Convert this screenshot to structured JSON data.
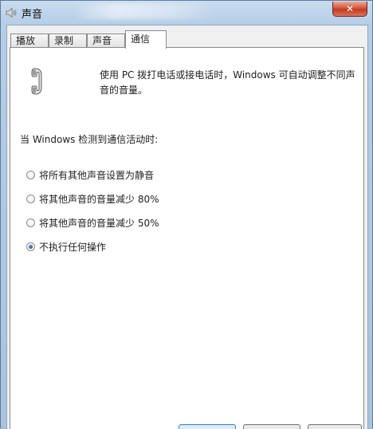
{
  "window": {
    "title": "声音",
    "close_glyph": "✕"
  },
  "tabs": [
    {
      "label": "播放"
    },
    {
      "label": "录制"
    },
    {
      "label": "声音"
    },
    {
      "label": "通信",
      "active": true
    }
  ],
  "communications": {
    "description": "使用 PC 拨打电话或接电话时，Windows 可自动调整不同声音的音量。",
    "when_label": "当 Windows 检测到通信活动时:",
    "options": [
      {
        "label": "将所有其他声音设置为静音",
        "checked": false
      },
      {
        "label": "将其他声音的音量减少 80%",
        "checked": false
      },
      {
        "label": "将其他声音的音量减少 50%",
        "checked": false
      },
      {
        "label": "不执行任何操作",
        "checked": true
      }
    ]
  },
  "colors": {
    "title_bar": "#b5cde6",
    "close_button": "#c23a22",
    "panel": "#ffffff",
    "dialog": "#f0f0f0"
  },
  "icons": {
    "app": "speaker-icon",
    "phone": "telephone-handset-icon"
  }
}
